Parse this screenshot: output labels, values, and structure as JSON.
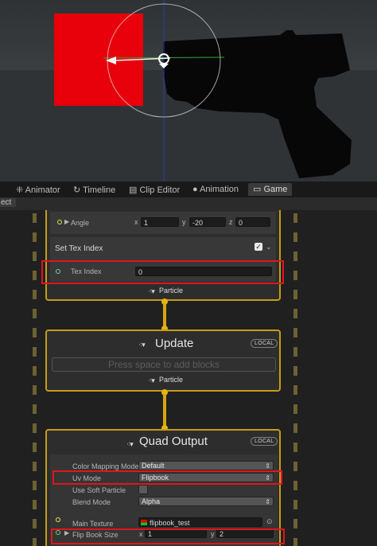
{
  "tabs": [
    {
      "label": "Animator",
      "icon": "animator-icon"
    },
    {
      "label": "Timeline",
      "icon": "timeline-icon"
    },
    {
      "label": "Clip Editor",
      "icon": "clip-editor-icon"
    },
    {
      "label": "Animation",
      "icon": "animation-icon"
    },
    {
      "label": "Game",
      "icon": "game-icon",
      "active": true
    }
  ],
  "subbar": {
    "label": "ect"
  },
  "angle_row": {
    "label": "Angle",
    "x_label": "x",
    "x_value": "1",
    "y_label": "y",
    "y_value": "-20",
    "z_label": "z",
    "z_value": "0"
  },
  "set_tex_index": {
    "title": "Set Tex Index",
    "checked": true,
    "field_label": "Tex Index",
    "field_value": "0"
  },
  "particle_label_1": "Particle",
  "update": {
    "title": "Update",
    "badge": "LOCAL",
    "placeholder": "Press space to add blocks",
    "output_label": "Particle"
  },
  "quad_output": {
    "title": "Quad Output",
    "badge": "LOCAL",
    "color_mapping_label": "Color Mapping Mode",
    "color_mapping_value": "Default",
    "uv_mode_label": "Uv Mode",
    "uv_mode_value": "Flipbook",
    "soft_particle_label": "Use Soft Particle",
    "blend_mode_label": "Blend Mode",
    "blend_mode_value": "Alpha",
    "main_texture_label": "Main Texture",
    "main_texture_value": "flipbook_test",
    "flip_book_label": "Flip Book Size",
    "flip_x_label": "x",
    "flip_x_value": "1",
    "flip_y_label": "y",
    "flip_y_value": "2"
  },
  "colors": {
    "context_border": "#c79b19",
    "highlight": "#e0161a",
    "quad": "#e8000a"
  }
}
